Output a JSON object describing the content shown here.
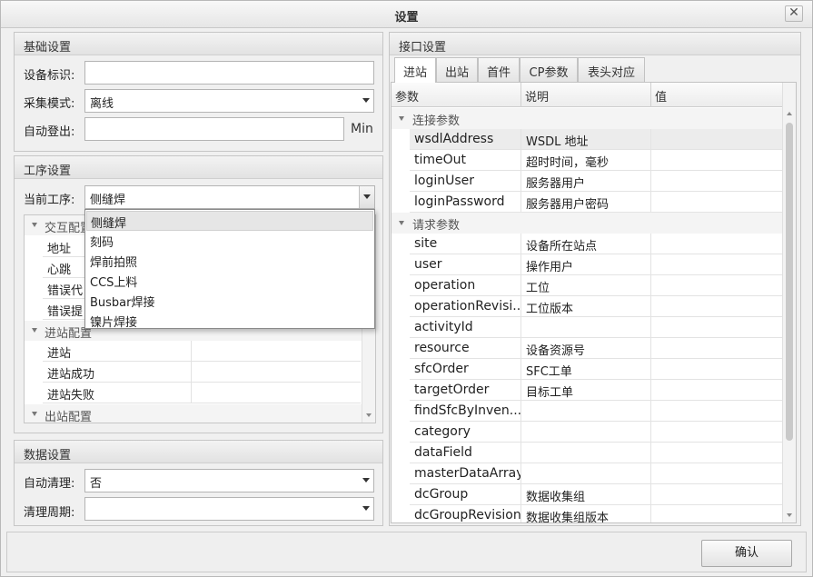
{
  "window": {
    "title": "设置",
    "close_symbol": "✕"
  },
  "basic": {
    "heading": "基础设置",
    "device_id_label": "设备标识:",
    "device_id_value": "",
    "collect_mode_label": "采集模式:",
    "collect_mode_value": "离线",
    "auto_logout_label": "自动登出:",
    "auto_logout_value": "",
    "auto_logout_unit": "Min"
  },
  "process": {
    "heading": "工序设置",
    "current_label": "当前工序:",
    "current_value": "侧缝焊",
    "dropdown_options": [
      "侧缝焊",
      "刻码",
      "焊前拍照",
      "CCS上料",
      "Busbar焊接",
      "镍片焊接"
    ],
    "categories": [
      {
        "name": "交互配置",
        "rows": [
          "地址",
          "心跳",
          "错误代",
          "错误提"
        ]
      },
      {
        "name": "进站配置",
        "rows": [
          "进站",
          "进站成功",
          "进站失败"
        ]
      },
      {
        "name": "出站配置",
        "rows": []
      }
    ]
  },
  "data": {
    "heading": "数据设置",
    "auto_clean_label": "自动清理:",
    "auto_clean_value": "否",
    "clean_cycle_label": "清理周期:",
    "clean_cycle_value": ""
  },
  "interface": {
    "heading": "接口设置",
    "tabs": [
      "进站",
      "出站",
      "首件",
      "CP参数",
      "表头对应"
    ],
    "active_tab": "进站",
    "columns": [
      "参数",
      "说明",
      "值"
    ],
    "categories": [
      {
        "name": "连接参数",
        "rows": [
          {
            "param": "wsdlAddress",
            "desc": "WSDL 地址",
            "value": ""
          },
          {
            "param": "timeOut",
            "desc": "超时时间，毫秒",
            "value": ""
          },
          {
            "param": "loginUser",
            "desc": "服务器用户",
            "value": ""
          },
          {
            "param": "loginPassword",
            "desc": "服务器用户密码",
            "value": ""
          }
        ]
      },
      {
        "name": "请求参数",
        "rows": [
          {
            "param": "site",
            "desc": "设备所在站点",
            "value": ""
          },
          {
            "param": "user",
            "desc": "操作用户",
            "value": ""
          },
          {
            "param": "operation",
            "desc": "工位",
            "value": ""
          },
          {
            "param": "operationRevisi...",
            "desc": "工位版本",
            "value": ""
          },
          {
            "param": "activityId",
            "desc": "",
            "value": ""
          },
          {
            "param": "resource",
            "desc": "设备资源号",
            "value": ""
          },
          {
            "param": "sfcOrder",
            "desc": "SFC工单",
            "value": ""
          },
          {
            "param": "targetOrder",
            "desc": "目标工单",
            "value": ""
          },
          {
            "param": "findSfcByInven...",
            "desc": "",
            "value": ""
          },
          {
            "param": "category",
            "desc": "",
            "value": ""
          },
          {
            "param": "dataField",
            "desc": "",
            "value": ""
          },
          {
            "param": "masterDataArray",
            "desc": "",
            "value": ""
          },
          {
            "param": "dcGroup",
            "desc": "数据收集组",
            "value": ""
          },
          {
            "param": "dcGroupRevision",
            "desc": "数据收集组版本",
            "value": ""
          }
        ]
      }
    ]
  },
  "footer": {
    "ok_label": "确认"
  }
}
